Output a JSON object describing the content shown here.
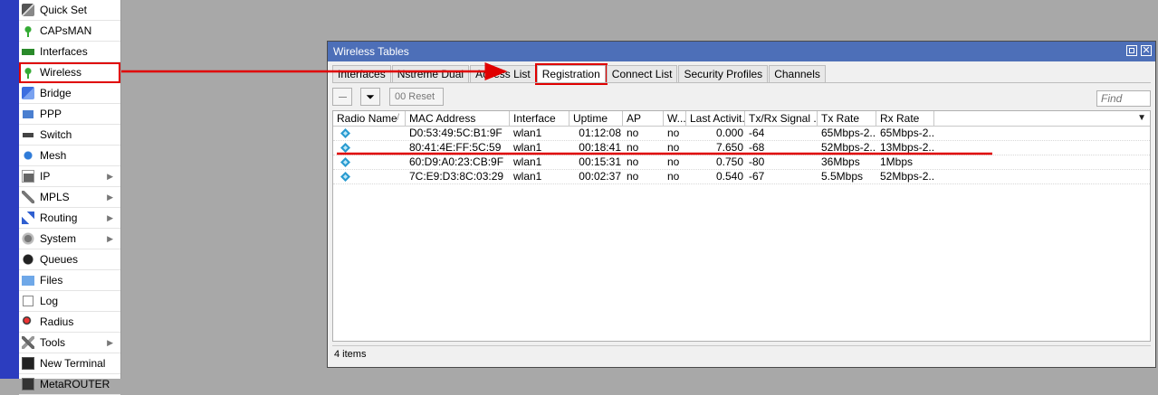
{
  "sidebar": {
    "items": [
      {
        "label": "Quick Set",
        "icon": "wand-icon",
        "submenu": false
      },
      {
        "label": "CAPsMAN",
        "icon": "capsman-icon",
        "submenu": false
      },
      {
        "label": "Interfaces",
        "icon": "interfaces-icon",
        "submenu": false
      },
      {
        "label": "Wireless",
        "icon": "wireless-icon",
        "submenu": false,
        "highlighted": true
      },
      {
        "label": "Bridge",
        "icon": "bridge-icon",
        "submenu": false
      },
      {
        "label": "PPP",
        "icon": "ppp-icon",
        "submenu": false
      },
      {
        "label": "Switch",
        "icon": "switch-icon",
        "submenu": false
      },
      {
        "label": "Mesh",
        "icon": "mesh-icon",
        "submenu": false
      },
      {
        "label": "IP",
        "icon": "ip-icon",
        "submenu": true
      },
      {
        "label": "MPLS",
        "icon": "mpls-icon",
        "submenu": true
      },
      {
        "label": "Routing",
        "icon": "routing-icon",
        "submenu": true
      },
      {
        "label": "System",
        "icon": "system-icon",
        "submenu": true
      },
      {
        "label": "Queues",
        "icon": "queues-icon",
        "submenu": false
      },
      {
        "label": "Files",
        "icon": "files-icon",
        "submenu": false
      },
      {
        "label": "Log",
        "icon": "log-icon",
        "submenu": false
      },
      {
        "label": "Radius",
        "icon": "radius-icon",
        "submenu": false
      },
      {
        "label": "Tools",
        "icon": "tools-icon",
        "submenu": true
      },
      {
        "label": "New Terminal",
        "icon": "terminal-icon",
        "submenu": false
      },
      {
        "label": "MetaROUTER",
        "icon": "metarouter-icon",
        "submenu": false
      }
    ],
    "submenu_arrow": "▶"
  },
  "window": {
    "title": "Wireless Tables",
    "close_glyph": "✕",
    "tabs": [
      {
        "label": "Interfaces",
        "active": false
      },
      {
        "label": "Nstreme Dual",
        "active": false
      },
      {
        "label": "Access List",
        "active": false
      },
      {
        "label": "Registration",
        "active": true
      },
      {
        "label": "Connect List",
        "active": false
      },
      {
        "label": "Security Profiles",
        "active": false
      },
      {
        "label": "Channels",
        "active": false
      }
    ],
    "toolbar": {
      "filter_glyph": "⏷",
      "reset_label": "00  Reset",
      "find_placeholder": "Find"
    },
    "table": {
      "columns": [
        "Radio Name",
        "MAC Address",
        "Interface",
        "Uptime",
        "AP",
        "W...",
        "Last Activit...",
        "Tx/Rx Signal ...",
        "Tx Rate",
        "Rx Rate"
      ],
      "sort_mark": "/",
      "column_menu_glyph": "▼",
      "rows": [
        {
          "radio_name": "",
          "mac": "D0:53:49:5C:B1:9F",
          "iface": "wlan1",
          "uptime": "01:12:08",
          "ap": "no",
          "wds": "no",
          "last": "0.000",
          "signal": "-64",
          "tx": "65Mbps-2...",
          "rx": "65Mbps-2..."
        },
        {
          "radio_name": "",
          "mac": "80:41:4E:FF:5C:59",
          "iface": "wlan1",
          "uptime": "00:18:41",
          "ap": "no",
          "wds": "no",
          "last": "7.650",
          "signal": "-68",
          "tx": "52Mbps-2...",
          "rx": "13Mbps-2..."
        },
        {
          "radio_name": "",
          "mac": "60:D9:A0:23:CB:9F",
          "iface": "wlan1",
          "uptime": "00:15:31",
          "ap": "no",
          "wds": "no",
          "last": "0.750",
          "signal": "-80",
          "tx": "36Mbps",
          "rx": "1Mbps"
        },
        {
          "radio_name": "",
          "mac": "7C:E9:D3:8C:03:29",
          "iface": "wlan1",
          "uptime": "00:02:37",
          "ap": "no",
          "wds": "no",
          "last": "0.540",
          "signal": "-67",
          "tx": "5.5Mbps",
          "rx": "52Mbps-2..."
        }
      ]
    },
    "status": "4 items"
  },
  "annotation_color": "#e00000"
}
